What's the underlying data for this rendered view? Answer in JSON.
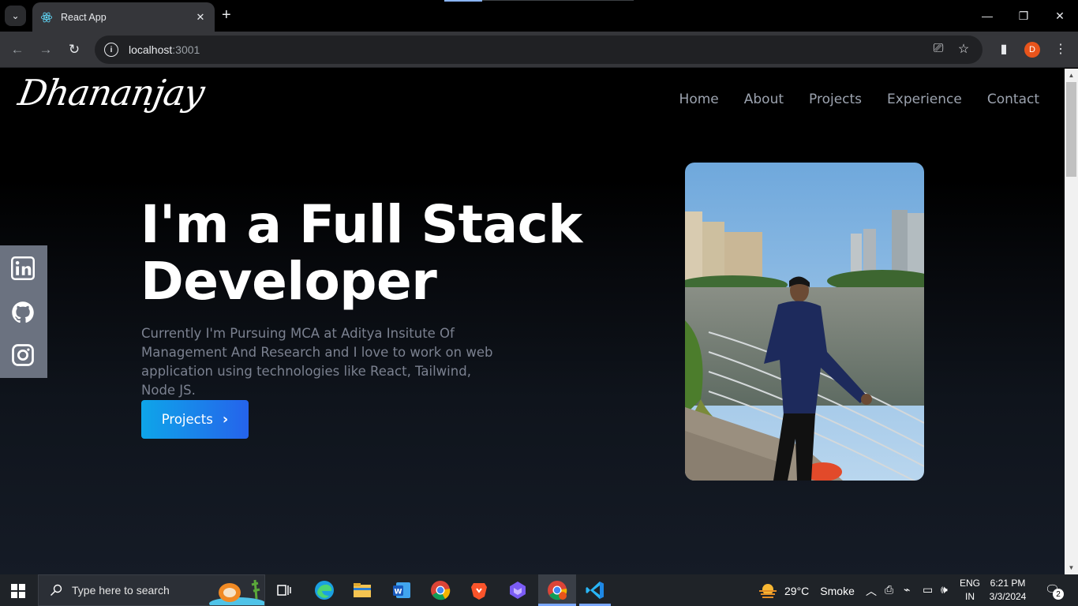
{
  "browser": {
    "tab_title": "React App",
    "url_host": "localhost",
    "url_port": ":3001",
    "profile_initial": "D"
  },
  "page": {
    "logo": "Dhananjay",
    "nav": [
      "Home",
      "About",
      "Projects",
      "Experience",
      "Contact"
    ],
    "heading_line1": "I'm a Full Stack",
    "heading_line2": "Developer",
    "intro": "Currently I'm Pursuing MCA at Aditya Insitute Of Management And Research and I love to work on web application using technologies like React, Tailwind, Node JS.",
    "cta_label": "Projects",
    "social": [
      "linkedin-icon",
      "github-icon",
      "instagram-icon"
    ]
  },
  "taskbar": {
    "search_placeholder": "Type here to search",
    "weather_temp": "29°C",
    "weather_desc": "Smoke",
    "lang_line1": "ENG",
    "lang_line2": "IN",
    "time": "6:21 PM",
    "date": "3/3/2024",
    "notifications": "2"
  }
}
